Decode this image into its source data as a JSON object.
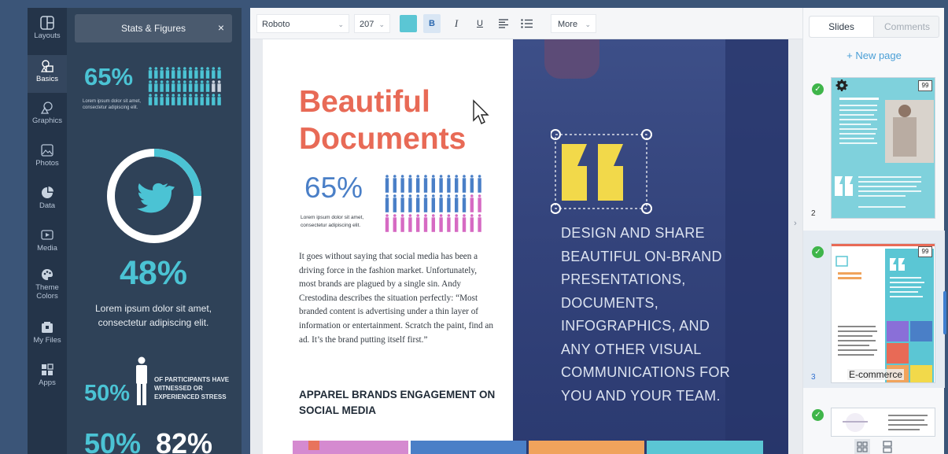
{
  "rail": {
    "items": [
      {
        "label": "Layouts",
        "icon": "layout-icon"
      },
      {
        "label": "Basics",
        "icon": "shapes-icon"
      },
      {
        "label": "Graphics",
        "icon": "graphics-icon"
      },
      {
        "label": "Photos",
        "icon": "image-icon"
      },
      {
        "label": "Data",
        "icon": "pie-chart-icon"
      },
      {
        "label": "Media",
        "icon": "media-icon"
      },
      {
        "label": "Theme Colors",
        "icon": "palette-icon"
      },
      {
        "label": "My Files",
        "icon": "files-icon"
      },
      {
        "label": "Apps",
        "icon": "apps-icon"
      }
    ]
  },
  "panel": {
    "title": "Stats & Figures",
    "close": "×",
    "stat1": "65%",
    "stat1_text": "Lorem ipsum dolor sit amet, consectetur adipiscing elit.",
    "stat2": "48%",
    "stat2_text": "Lorem ipsum dolor sit amet, consectetur adipiscing elit.",
    "stat3": "50%",
    "stat3_text": "OF PARTICIPANTS HAVE WITNESSED OR EXPERIENCED STRESS",
    "stat4": "50%",
    "stat5": "82%"
  },
  "toolbar": {
    "font": "Roboto",
    "size": "207",
    "color": "#5bc6d4",
    "bold": "B",
    "italic": "I",
    "underline": "U",
    "more": "More"
  },
  "document": {
    "title_line1": "Beautiful",
    "title_line2": "Documents",
    "stat": "65%",
    "stat_text": "Lorem ipsum dolor sit amet, consectetur adipiscing elit.",
    "body": "It goes without saying that social media has been a driving force in the fashion market. Unfortunately, most brands are plagued by a single sin. Andy Crestodina describes the situation perfectly: “Most branded content is advertising under a thin layer of information or entertainment. Scratch the paint, find an ad. It’s the brand putting itself first.”",
    "heading2": "APPAREL BRANDS ENGAGEMENT ON SOCIAL MEDIA",
    "photo_text": "DESIGN AND SHARE BEAUTIFUL ON-BRAND PRESENTATIONS, DOCUMENTS, INFOGRAPHICS, AND ANY OTHER VISUAL COMMUNICATIONS FOR YOU AND YOUR TEAM."
  },
  "colors": {
    "accent": "#e86a56",
    "teal": "#4bc3d4",
    "blue": "#4a7fc7",
    "pink": "#d66ac3",
    "check": "#3fb54a"
  },
  "sidebar_right": {
    "tabs": [
      "Slides",
      "Comments"
    ],
    "new_page": "+ New page",
    "thumbs": [
      {
        "num": "2",
        "badge": "99",
        "label": ""
      },
      {
        "num": "3",
        "badge": "99",
        "label": "E-commerce"
      },
      {
        "num": "",
        "badge": "",
        "label": ""
      }
    ]
  }
}
